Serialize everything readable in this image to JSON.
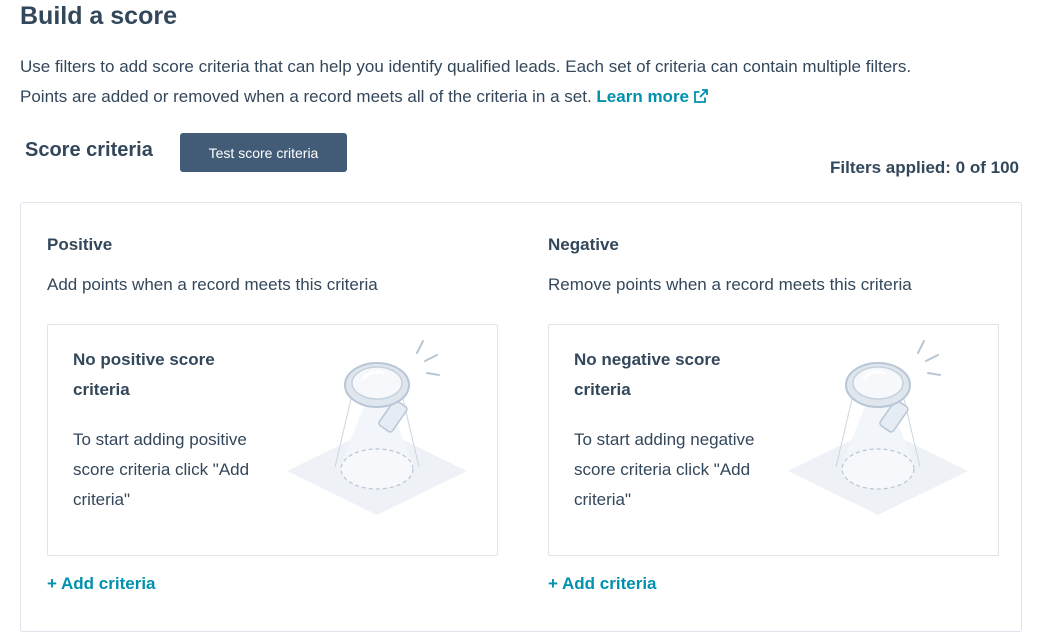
{
  "page": {
    "title": "Build a score",
    "intro_line1": "Use filters to add score criteria that can help you identify qualified leads. Each set of criteria can contain multiple filters.",
    "intro_line2": "Points are added or removed when a record meets all of the criteria in a set.",
    "learn_more": "Learn more",
    "learn_more_icon": "external-link-icon"
  },
  "score_criteria": {
    "title": "Score criteria",
    "test_button": "Test score criteria",
    "filters_applied": "Filters applied: 0 of 100"
  },
  "positive": {
    "heading": "Positive",
    "description": "Add points when a record meets this criteria",
    "empty_title": "No positive score criteria",
    "empty_text": "To start adding positive score criteria click \"Add criteria\"",
    "add_label": "+ Add criteria",
    "illustration_icon": "magnifying-glass-illustration"
  },
  "negative": {
    "heading": "Negative",
    "description": "Remove points when a record meets this criteria",
    "empty_title": "No negative score criteria",
    "empty_text": "To start adding negative score criteria click \"Add criteria\"",
    "add_label": "+ Add criteria",
    "illustration_icon": "magnifying-glass-illustration"
  },
  "colors": {
    "text": "#33475b",
    "link": "#0091ae",
    "button_bg": "#425b76",
    "border": "#dfe3eb"
  }
}
